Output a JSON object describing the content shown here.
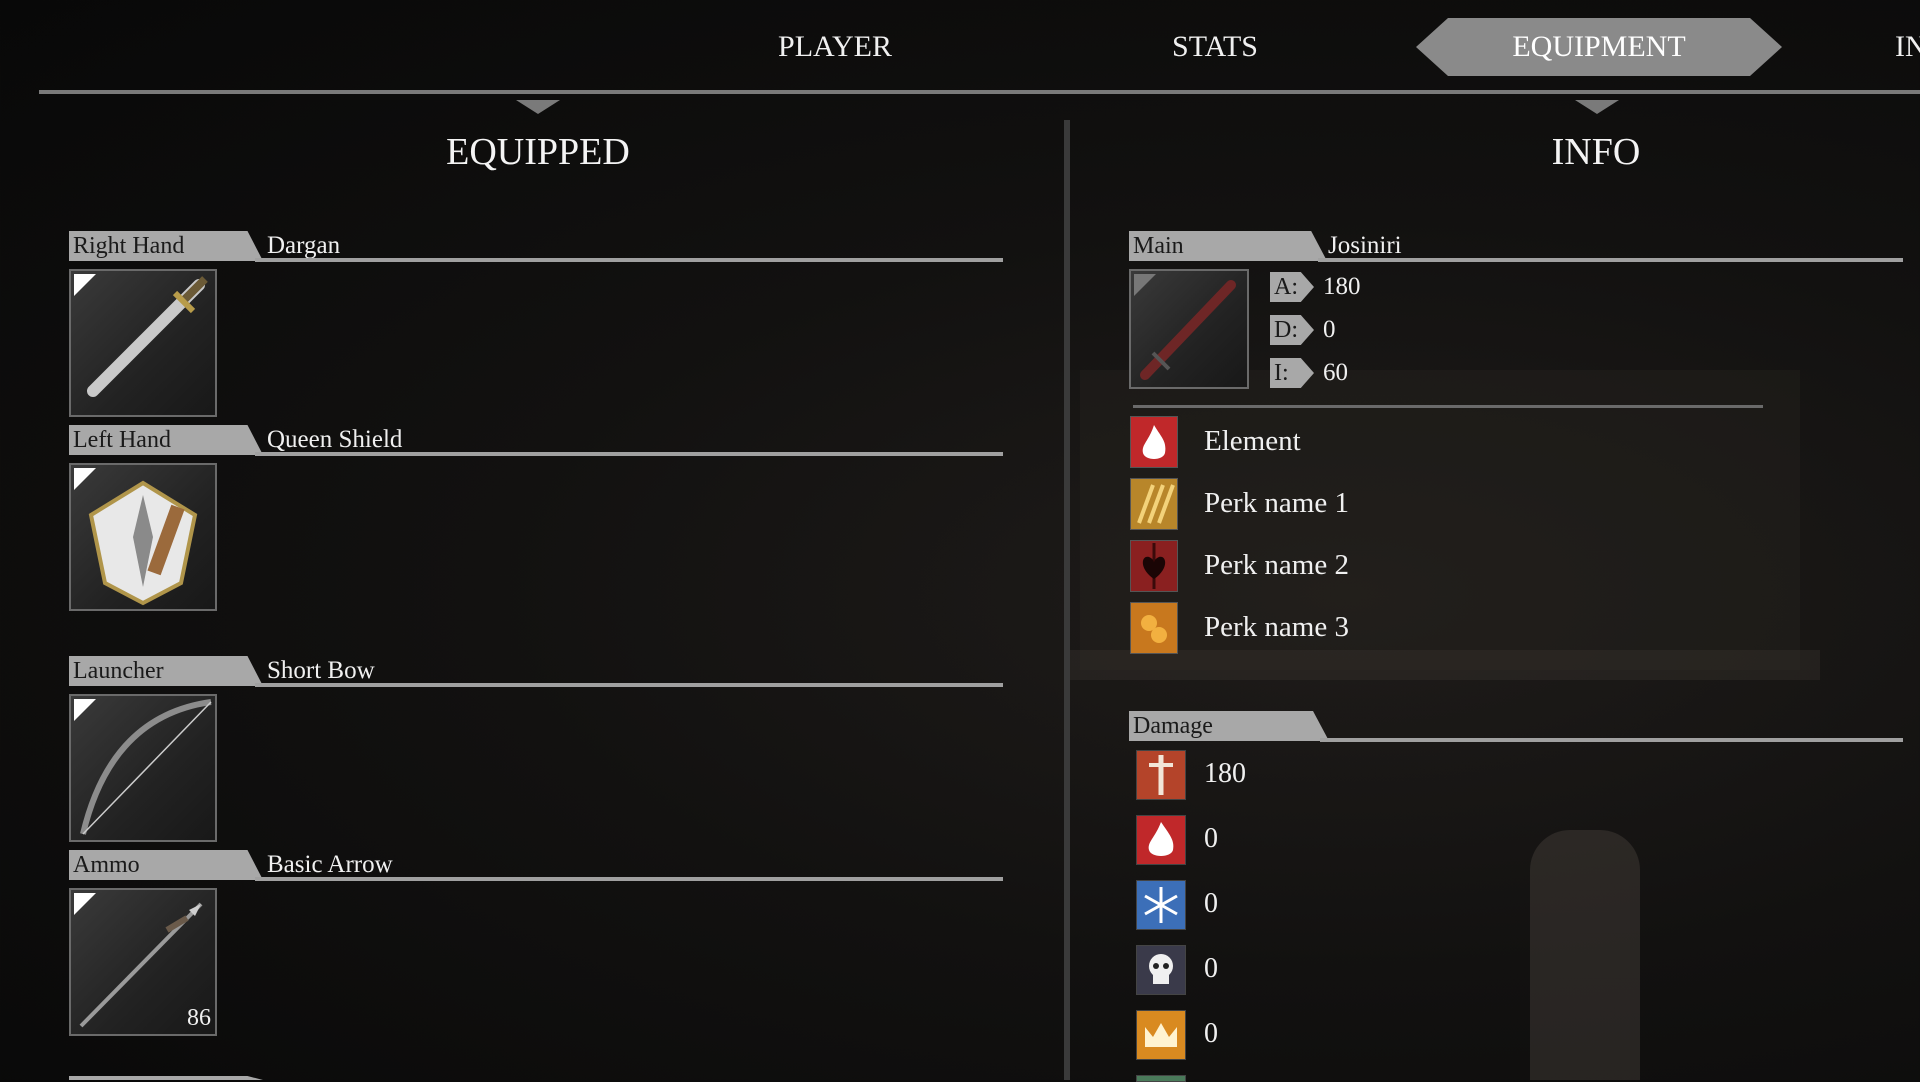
{
  "nav": {
    "tabs": [
      {
        "label": "PLAYER"
      },
      {
        "label": "STATS"
      },
      {
        "label": "EQUIPMENT",
        "active": true
      },
      {
        "label": "IN"
      }
    ]
  },
  "equipped": {
    "title": "EQUIPPED",
    "slots": [
      {
        "label": "Right Hand",
        "name": "Dargan",
        "icon": "sword-icon"
      },
      {
        "label": "Left Hand",
        "name": "Queen Shield",
        "icon": "shield-icon"
      },
      {
        "label": "Launcher",
        "name": "Short Bow",
        "icon": "bow-icon"
      },
      {
        "label": "Ammo",
        "name": "Basic Arrow",
        "icon": "arrow-icon",
        "count": "86"
      }
    ]
  },
  "info": {
    "title": "INFO",
    "main_label": "Main",
    "item_name": "Josiniri",
    "item_icon": "katana-icon",
    "stats": [
      {
        "tag": "A:",
        "value": "180"
      },
      {
        "tag": "D:",
        "value": "0"
      },
      {
        "tag": "I:",
        "value": "60"
      }
    ],
    "perks": [
      {
        "icon": "fire-element-icon",
        "label": "Element"
      },
      {
        "icon": "triple-blades-icon",
        "label": "Perk name 1"
      },
      {
        "icon": "bleed-heart-icon",
        "label": "Perk name 2"
      },
      {
        "icon": "coins-icon",
        "label": "Perk name 3"
      }
    ],
    "damage_label": "Damage",
    "damage": [
      {
        "icon": "physical-sword-icon",
        "value": "180"
      },
      {
        "icon": "fire-icon",
        "value": "0"
      },
      {
        "icon": "frost-icon",
        "value": "0"
      },
      {
        "icon": "poison-skull-icon",
        "value": "0"
      },
      {
        "icon": "holy-crown-icon",
        "value": "0"
      }
    ]
  },
  "colors": {
    "tab_active": "#8a8a8a",
    "label_bg": "#a8a8a8",
    "fire": "#c0282a",
    "frost": "#3c6fb8",
    "poison": "#3a3a4a",
    "holy": "#d98a20"
  }
}
